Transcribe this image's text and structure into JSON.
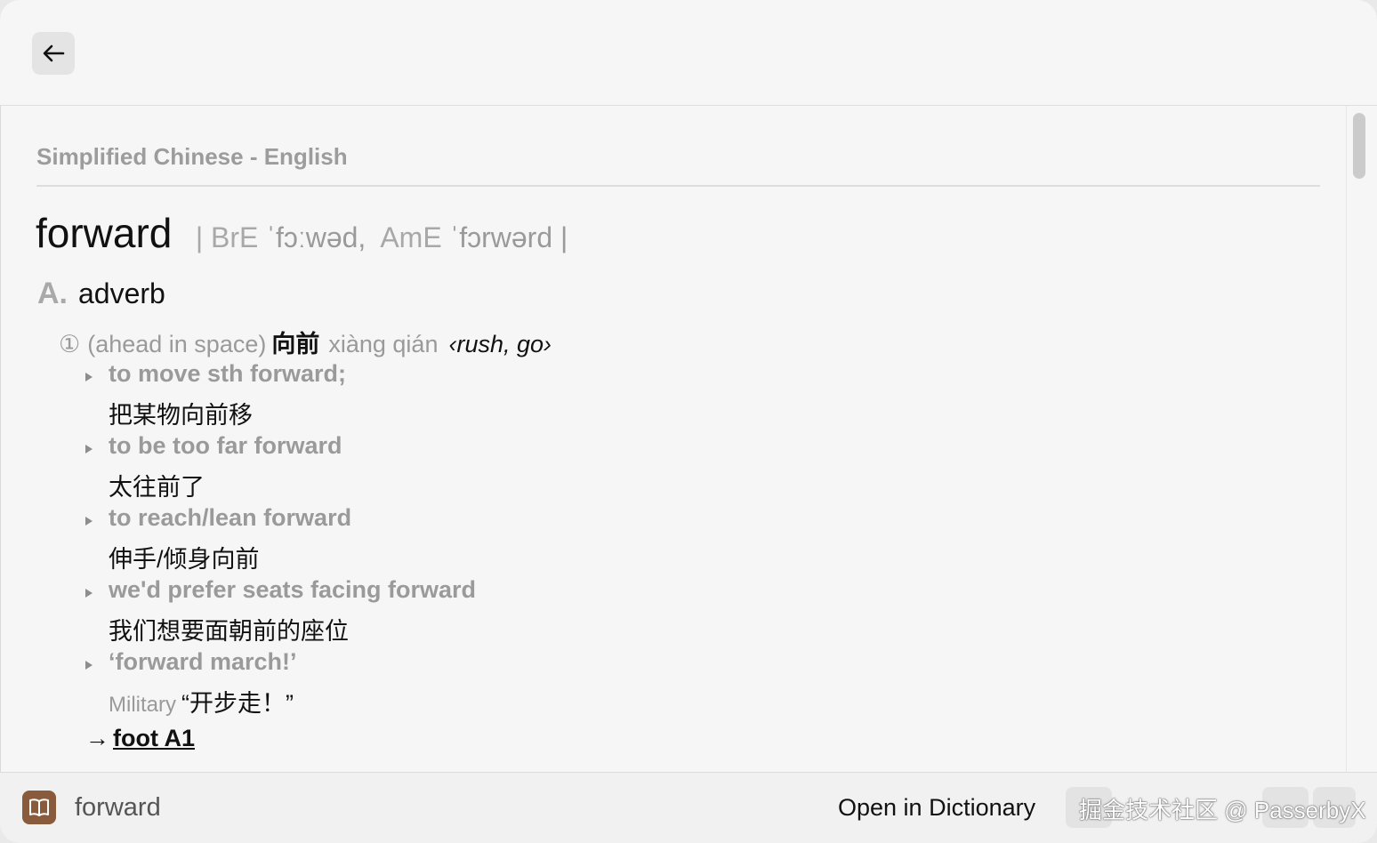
{
  "topbar": {
    "back_icon": "arrow-left-icon"
  },
  "entry": {
    "dictionary_name": "Simplified Chinese - English",
    "headword": "forward",
    "pron_open": "| BrE",
    "pron_bre_ipa": "ˈfɔːwəd,",
    "pron_ame_label": "AmE",
    "pron_ame_ipa": "ˈfɔrwərd |",
    "pos_letter": "A.",
    "pos_name": "adverb",
    "sense": {
      "number": "①",
      "gloss": "(ahead in space)",
      "chinese": "向前",
      "pinyin": "xiàng qián",
      "note": "‹rush, go›"
    },
    "examples": [
      {
        "en": "to move sth forward;",
        "zh": "把某物向前移"
      },
      {
        "en": "to be too far forward",
        "zh": "太往前了"
      },
      {
        "en": "to reach/lean forward",
        "zh": "伸手/倾身向前"
      },
      {
        "en": "we'd prefer seats facing forward",
        "zh": "我们想要面朝前的座位"
      },
      {
        "en": "‘forward march!’",
        "label": "Military",
        "zh": "“开步走！”"
      }
    ],
    "xref_arrow": "→",
    "xref_link": "foot A1"
  },
  "bottom": {
    "word": "forward",
    "open_label": "Open in Dictionary",
    "book_icon": "book-icon",
    "watermark": "掘金技术社区 @ PasserbyX"
  }
}
